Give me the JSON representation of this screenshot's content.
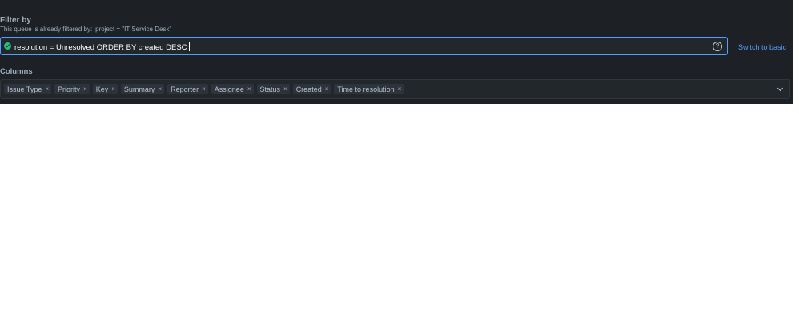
{
  "filter": {
    "title": "Filter by",
    "note_prefix": "This queue is already filtered by:",
    "note_query": "project = \"IT Service Desk\"",
    "jql": "resolution = Unresolved ORDER BY created DESC",
    "help_icon": "question-circle-icon",
    "valid_icon": "check-circle-icon",
    "switch_label": "Switch to basic"
  },
  "columns": {
    "title": "Columns",
    "items": [
      {
        "label": "Issue Type"
      },
      {
        "label": "Priority"
      },
      {
        "label": "Key"
      },
      {
        "label": "Summary"
      },
      {
        "label": "Reporter"
      },
      {
        "label": "Assignee"
      },
      {
        "label": "Status"
      },
      {
        "label": "Created"
      },
      {
        "label": "Time to resolution"
      }
    ]
  },
  "colors": {
    "panel_bg": "#1d2125",
    "accent": "#579dff",
    "valid": "#2abb7f"
  }
}
